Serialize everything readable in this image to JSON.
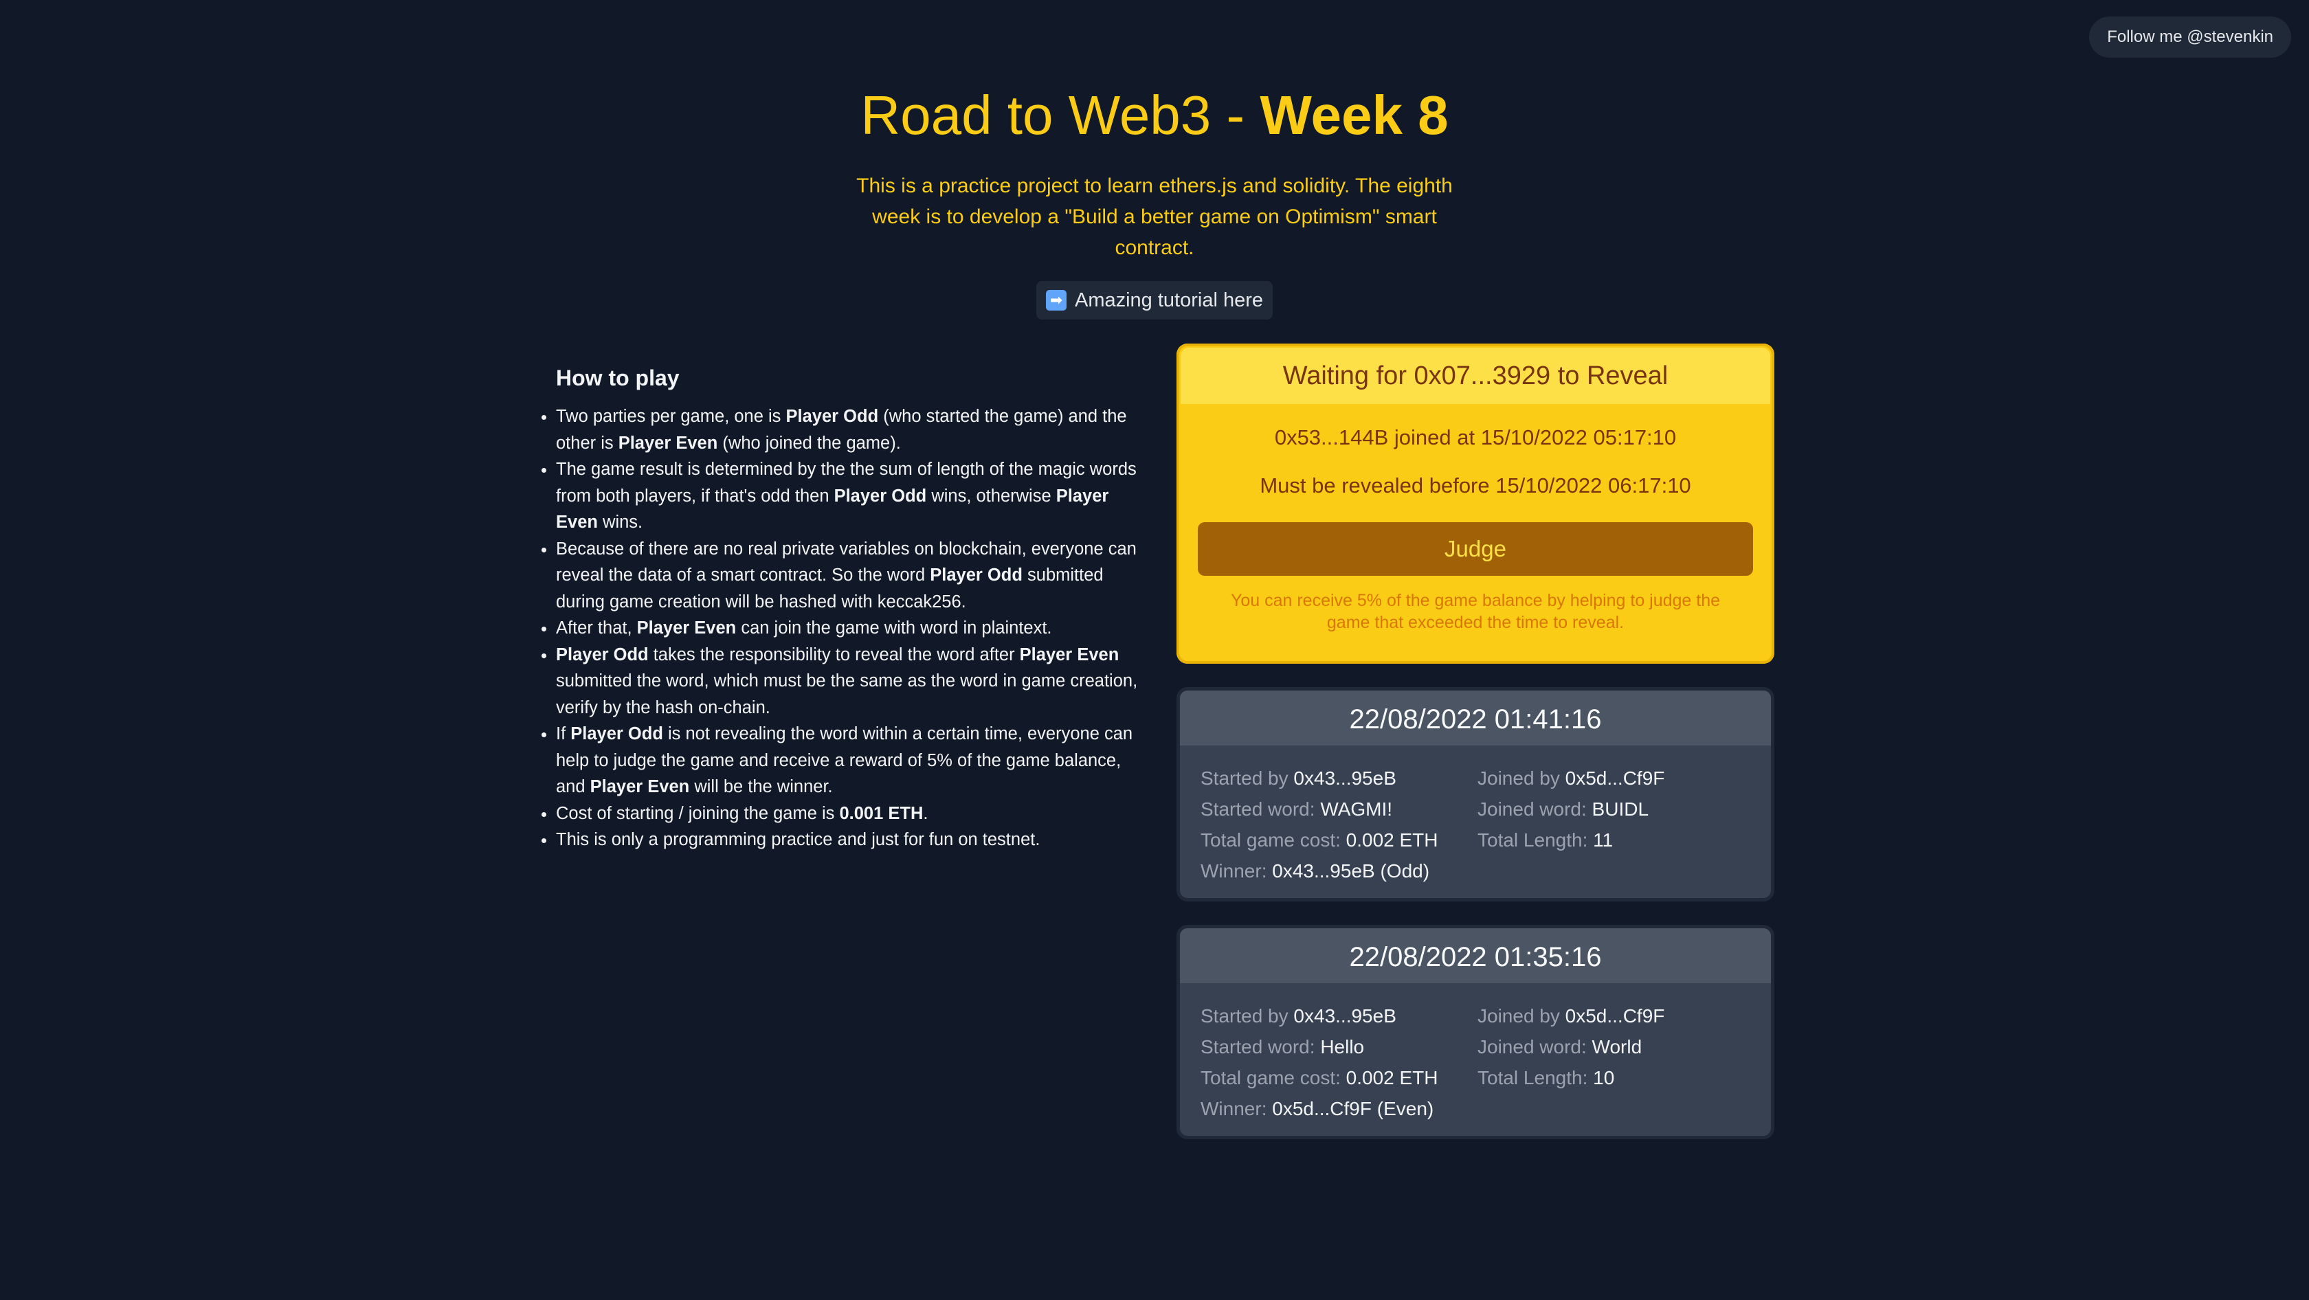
{
  "header": {
    "follow_label": "Follow me @stevenkin"
  },
  "hero": {
    "title_prefix": "Road to Web3 - ",
    "title_bold": "Week 8",
    "description": "This is a practice project to learn ethers.js and solidity. The eighth week is to develop a \"Build a better game on Optimism\" smart contract.",
    "tutorial_icon": "➡",
    "tutorial_label": "Amazing tutorial here"
  },
  "howto": {
    "title": "How to play",
    "items": [
      [
        {
          "t": "Two parties per game, one is "
        },
        {
          "b": "Player Odd"
        },
        {
          "t": " (who started the game) and the other is "
        },
        {
          "b": "Player Even"
        },
        {
          "t": " (who joined the game)."
        }
      ],
      [
        {
          "t": "The game result is determined by the the sum of length of the magic words from both players, if that's odd then "
        },
        {
          "b": "Player Odd"
        },
        {
          "t": " wins, otherwise "
        },
        {
          "b": "Player Even"
        },
        {
          "t": " wins."
        }
      ],
      [
        {
          "t": "Because of there are no real private variables on blockchain, everyone can reveal the data of a smart contract. So the word "
        },
        {
          "b": "Player Odd"
        },
        {
          "t": " submitted during game creation will be hashed with keccak256."
        }
      ],
      [
        {
          "t": "After that, "
        },
        {
          "b": "Player Even"
        },
        {
          "t": " can join the game with word in plaintext."
        }
      ],
      [
        {
          "b": "Player Odd"
        },
        {
          "t": " takes the responsibility to reveal the word after "
        },
        {
          "b": "Player Even"
        },
        {
          "t": " submitted the word, which must be the same as the word in game creation, verify by the hash on-chain."
        }
      ],
      [
        {
          "t": "If "
        },
        {
          "b": "Player Odd"
        },
        {
          "t": " is not revealing the word within a certain time, everyone can help to judge the game and receive a reward of 5% of the game balance, and "
        },
        {
          "b": "Player Even"
        },
        {
          "t": " will be the winner."
        }
      ],
      [
        {
          "t": "Cost of starting / joining the game is "
        },
        {
          "b": "0.001 ETH"
        },
        {
          "t": "."
        }
      ],
      [
        {
          "t": "This is only a programming practice and just for fun on testnet."
        }
      ]
    ]
  },
  "current_game": {
    "status": "Waiting for 0x07...3929 to Reveal",
    "joined_line": "0x53...144B joined at 15/10/2022 05:17:10",
    "deadline_line": "Must be revealed before 15/10/2022 06:17:10",
    "judge_label": "Judge",
    "hint": "You can receive 5% of the game balance by helping to judge the game that exceeded the time to reveal."
  },
  "games": [
    {
      "datetime": "22/08/2022 01:41:16",
      "started_by_label": "Started by",
      "started_by": "0x43...95eB",
      "joined_by_label": "Joined by",
      "joined_by": "0x5d...Cf9F",
      "started_word_label": "Started word:",
      "started_word": "WAGMI!",
      "joined_word_label": "Joined word:",
      "joined_word": "BUIDL",
      "cost_label": "Total game cost:",
      "cost": "0.002 ETH",
      "length_label": "Total Length:",
      "length": "11",
      "winner_label": "Winner:",
      "winner": "0x43...95eB (Odd)"
    },
    {
      "datetime": "22/08/2022 01:35:16",
      "started_by_label": "Started by",
      "started_by": "0x43...95eB",
      "joined_by_label": "Joined by",
      "joined_by": "0x5d...Cf9F",
      "started_word_label": "Started word:",
      "started_word": "Hello",
      "joined_word_label": "Joined word:",
      "joined_word": "World",
      "cost_label": "Total game cost:",
      "cost": "0.002 ETH",
      "length_label": "Total Length:",
      "length": "10",
      "winner_label": "Winner:",
      "winner": "0x5d...Cf9F (Even)"
    }
  ]
}
